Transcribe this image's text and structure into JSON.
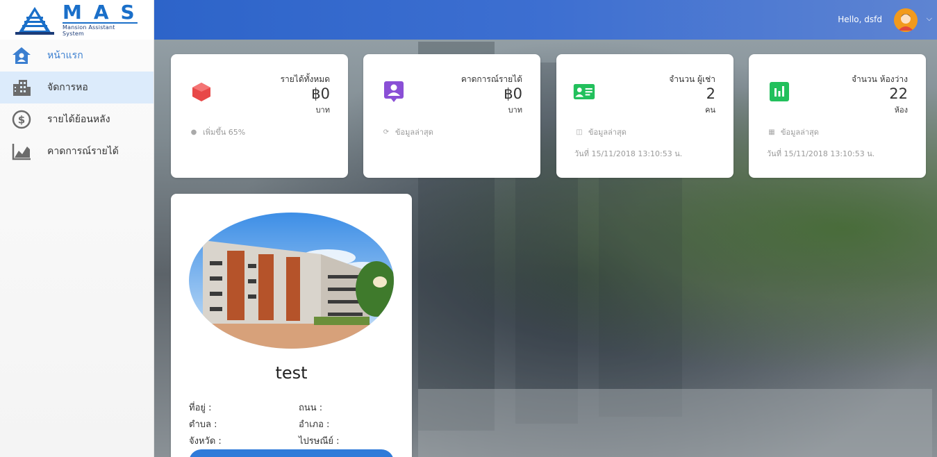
{
  "brand": {
    "title": "MAS",
    "subtitle": "Mansion Assistant System"
  },
  "sidebar": {
    "items": [
      {
        "label": "หน้าแรก",
        "icon": "home-icon",
        "color": "#3b7fd0"
      },
      {
        "label": "จัดการหอ",
        "icon": "building-icon",
        "color": "#6b6b6b"
      },
      {
        "label": "รายได้ย้อนหลัง",
        "icon": "dollar-circle-icon",
        "color": "#6b6b6b"
      },
      {
        "label": "คาดการณ์รายได้",
        "icon": "trend-chart-icon",
        "color": "#6b6b6b"
      }
    ]
  },
  "header": {
    "greeting": "Hello, dsfd"
  },
  "cards": [
    {
      "title": "รายได้ทั้งหมด",
      "value": "฿0",
      "unit": "บาท",
      "footer": "เพิ่มขึ้น 65%",
      "date": "",
      "icon": "cube-icon",
      "color": "#e84848"
    },
    {
      "title": "คาดการณ์รายได้",
      "value": "฿0",
      "unit": "บาท",
      "footer": "ข้อมูลล่าสุด",
      "date": "",
      "icon": "person-badge-icon",
      "color": "#8a4fd6"
    },
    {
      "title": "จำนวน ผู้เช่า",
      "value": "2",
      "unit": "คน",
      "footer": "ข้อมูลล่าสุด",
      "date": "วันที่ 15/11/2018 13:10:53 น.",
      "icon": "id-card-icon",
      "color": "#22c05c"
    },
    {
      "title": "จำนวน ห้องว่าง",
      "value": "22",
      "unit": "ห้อง",
      "footer": "ข้อมูลล่าสุด",
      "date": "วันที่ 15/11/2018 13:10:53 น.",
      "icon": "bar-chart-icon",
      "color": "#22c05c"
    }
  ],
  "dorm": {
    "name": "test",
    "address_label": "ที่อยู่ :",
    "road_label": "ถนน :",
    "subdistrict_label": "ตำบล :",
    "district_label": "อำเภอ :",
    "province_label": "จังหวัด :",
    "postcode_label": "ไปรษณีย์ :"
  }
}
